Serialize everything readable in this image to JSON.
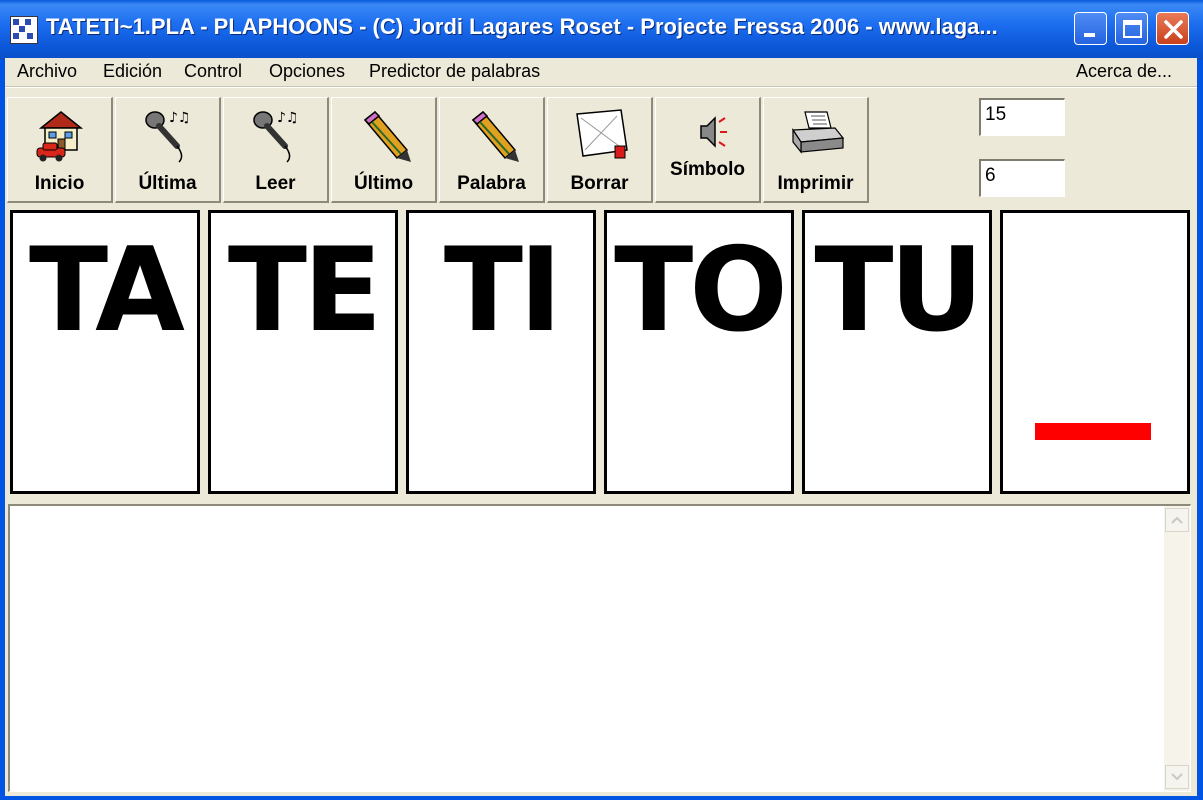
{
  "window": {
    "title": "TATETI~1.PLA - PLAPHOONS - (C) Jordi Lagares Roset - Projecte Fressa 2006 - www.laga..."
  },
  "menu": {
    "items": [
      "Archivo",
      "Edición",
      "Control",
      "Opciones",
      "Predictor de palabras"
    ],
    "about": "Acerca de..."
  },
  "toolbar": {
    "buttons": [
      {
        "label": "Inicio",
        "icon": "house-car-icon"
      },
      {
        "label": "Última",
        "icon": "microphone-icon"
      },
      {
        "label": "Leer",
        "icon": "microphone-icon"
      },
      {
        "label": "Último",
        "icon": "pencil-icon"
      },
      {
        "label": "Palabra",
        "icon": "pencil-icon"
      },
      {
        "label": "Borrar",
        "icon": "eraser-paper-icon"
      },
      {
        "label": "Símbolo",
        "icon": "speaker-icon"
      },
      {
        "label": "Imprimir",
        "icon": "printer-icon"
      }
    ],
    "field1": "15",
    "field2": "6"
  },
  "cards": [
    "TA",
    "TE",
    "TI",
    "TO",
    "TU",
    ""
  ],
  "colors": {
    "title_bar": "#0a58dc",
    "cursor": "#ff0000",
    "face": "#ece9d8"
  },
  "text_area": {
    "content": ""
  }
}
